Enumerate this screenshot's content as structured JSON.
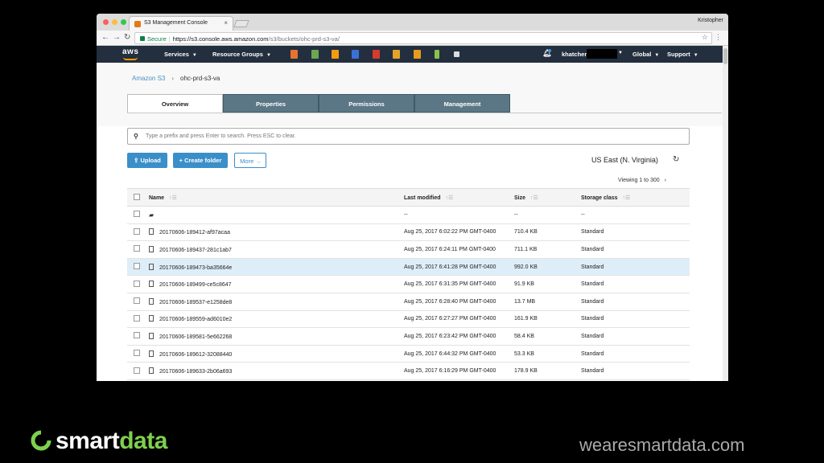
{
  "browser": {
    "tab_title": "S3 Management Console",
    "profile_name": "Kristopher",
    "secure_label": "Secure",
    "url_host": "https://s3.console.aws.amazon.com",
    "url_path": "/s3/buckets/ohc-prd-s3-va/"
  },
  "aws_nav": {
    "logo": "aws",
    "services": "Services",
    "resource_groups": "Resource Groups",
    "username": "khatcher",
    "region": "Global",
    "support": "Support"
  },
  "breadcrumb": {
    "root": "Amazon S3",
    "bucket": "ohc-prd-s3-va"
  },
  "tabs": [
    "Overview",
    "Properties",
    "Permissions",
    "Management"
  ],
  "search": {
    "placeholder": "Type a prefix and press Enter to search. Press ESC to clear."
  },
  "actions": {
    "upload": "Upload",
    "create_folder": "Create folder",
    "more": "More"
  },
  "region_label": "US East (N. Virginia)",
  "viewing": "Viewing 1 to 300",
  "columns": {
    "name": "Name",
    "last_modified": "Last modified",
    "size": "Size",
    "storage_class": "Storage class"
  },
  "folder_row": {
    "last_modified": "--",
    "size": "--",
    "storage_class": "--"
  },
  "rows": [
    {
      "name": "20170606-189412-af97acaa",
      "last_modified": "Aug 25, 2017 6:02:22 PM GMT-0400",
      "size": "710.4 KB",
      "storage_class": "Standard"
    },
    {
      "name": "20170606-189437-281c1ab7",
      "last_modified": "Aug 25, 2017 6:24:11 PM GMT-0400",
      "size": "711.1 KB",
      "storage_class": "Standard"
    },
    {
      "name": "20170606-189473-ba35664e",
      "last_modified": "Aug 25, 2017 6:41:28 PM GMT-0400",
      "size": "992.0 KB",
      "storage_class": "Standard"
    },
    {
      "name": "20170606-189499-ce5c8647",
      "last_modified": "Aug 25, 2017 6:31:35 PM GMT-0400",
      "size": "91.9 KB",
      "storage_class": "Standard"
    },
    {
      "name": "20170606-189537-e1258de8",
      "last_modified": "Aug 25, 2017 6:28:40 PM GMT-0400",
      "size": "13.7 MB",
      "storage_class": "Standard"
    },
    {
      "name": "20170606-189559-ad6010e2",
      "last_modified": "Aug 25, 2017 6:27:27 PM GMT-0400",
      "size": "161.9 KB",
      "storage_class": "Standard"
    },
    {
      "name": "20170606-189581-5e662268",
      "last_modified": "Aug 25, 2017 6:23:42 PM GMT-0400",
      "size": "58.4 KB",
      "storage_class": "Standard"
    },
    {
      "name": "20170606-189612-32088440",
      "last_modified": "Aug 25, 2017 6:44:32 PM GMT-0400",
      "size": "53.3 KB",
      "storage_class": "Standard"
    },
    {
      "name": "20170606-189633-2b06a693",
      "last_modified": "Aug 25, 2017 6:16:29 PM GMT-0400",
      "size": "178.9 KB",
      "storage_class": "Standard"
    }
  ],
  "branding": {
    "word_a": "smart",
    "word_b": "data",
    "site": "wearesmartdata.com"
  },
  "colors": {
    "aws_nav": "#232f3e",
    "aws_orange": "#ff9900",
    "tab_inactive": "#5b7786",
    "primary": "#3a8fc9",
    "brand_green": "#7ed04d"
  }
}
